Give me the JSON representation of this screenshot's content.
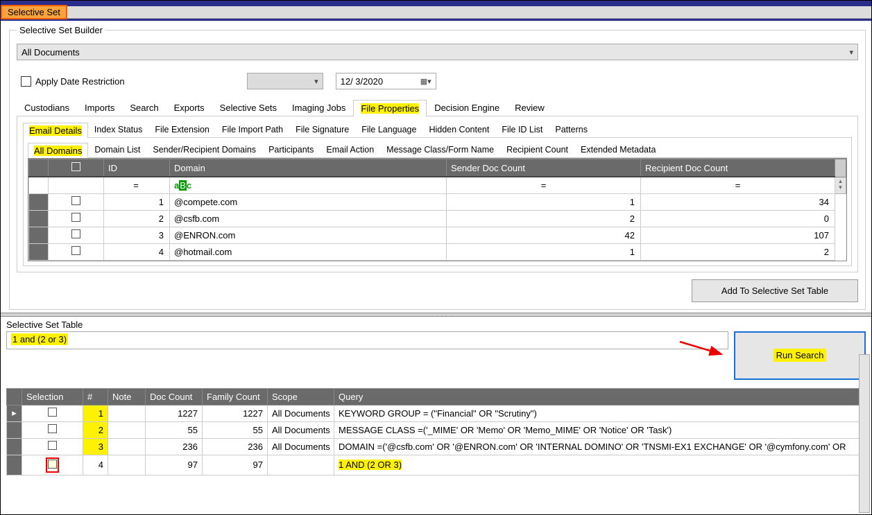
{
  "window": {
    "tab": "Selective Set"
  },
  "builder": {
    "legend": "Selective Set Builder",
    "doc_combo": "All Documents",
    "date_check_label": "Apply Date Restriction",
    "date_value": "12/ 3/2020",
    "tabs": [
      "Custodians",
      "Imports",
      "Search",
      "Exports",
      "Selective Sets",
      "Imaging Jobs",
      "File Properties",
      "Decision Engine",
      "Review"
    ],
    "active_tab": "File Properties",
    "sub_tabs": [
      "Email Details",
      "Index Status",
      "File Extension",
      "File Import Path",
      "File Signature",
      "File Language",
      "Hidden Content",
      "File ID List",
      "Patterns"
    ],
    "active_sub": "Email Details",
    "sub_tabs2": [
      "All Domains",
      "Domain List",
      "Sender/Recipient Domains",
      "Participants",
      "Email Action",
      "Message Class/Form Name",
      "Recipient Count",
      "Extended Metadata"
    ],
    "active_sub2": "All Domains",
    "grid_headers": [
      "",
      "",
      "ID",
      "Domain",
      "Sender Doc Count",
      "Recipient Doc Count"
    ],
    "filter_ops": {
      "id": "=",
      "domain": "a▯c",
      "sender": "=",
      "recipient": "="
    },
    "rows": [
      {
        "id": "1",
        "domain": "@compete.com",
        "sender": "1",
        "recipient": "34"
      },
      {
        "id": "2",
        "domain": "@csfb.com",
        "sender": "2",
        "recipient": "0"
      },
      {
        "id": "3",
        "domain": "@ENRON.com",
        "sender": "42",
        "recipient": "107"
      },
      {
        "id": "4",
        "domain": "@hotmail.com",
        "sender": "1",
        "recipient": "2"
      }
    ],
    "add_btn": "Add To Selective Set Table"
  },
  "selTable": {
    "legend": "Selective Set Table",
    "query": "1 and (2 or 3)",
    "run_btn": "Run Search",
    "headers": [
      "",
      "Selection",
      "#",
      "Note",
      "Doc Count",
      "Family Count",
      "Scope",
      "Query"
    ],
    "rows": [
      {
        "selRow": "▸",
        "idx": "1",
        "note": "",
        "doc": "1227",
        "fam": "1227",
        "scope": "All Documents",
        "q": "KEYWORD GROUP = (\"Financial\" OR \"Scrutiny\")",
        "hi": false,
        "red": false
      },
      {
        "selRow": "",
        "idx": "2",
        "note": "",
        "doc": "55",
        "fam": "55",
        "scope": "All Documents",
        "q": "MESSAGE CLASS =('_MIME' OR 'Memo' OR 'Memo_MIME' OR 'Notice' OR 'Task')",
        "hi": false,
        "red": false
      },
      {
        "selRow": "",
        "idx": "3",
        "note": "",
        "doc": "236",
        "fam": "236",
        "scope": "All Documents",
        "q": "DOMAIN =('@csfb.com' OR '@ENRON.com' OR 'INTERNAL DOMINO' OR 'TNSMI-EX1 EXCHANGE' OR '@cymfony.com' OR",
        "hi": false,
        "red": false
      },
      {
        "selRow": "",
        "idx": "4",
        "note": "",
        "doc": "97",
        "fam": "97",
        "scope": "",
        "q": "1 AND (2 OR 3)",
        "hi": true,
        "red": true
      }
    ]
  }
}
